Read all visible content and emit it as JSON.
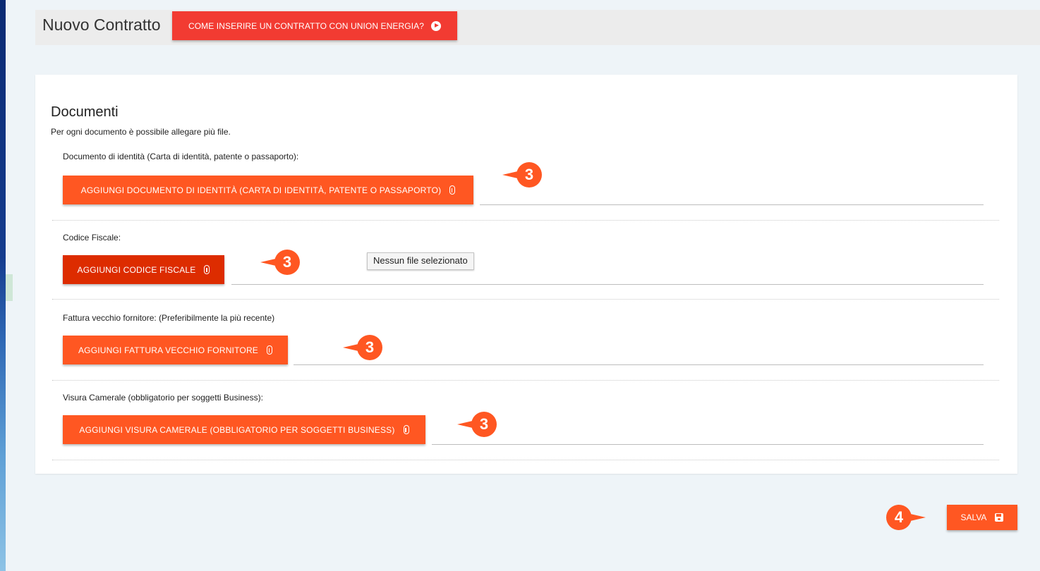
{
  "header": {
    "title": "Nuovo Contratto",
    "video_button_label": "COME INSERIRE UN CONTRATTO CON UNION ENERGIA?"
  },
  "documents": {
    "title": "Documenti",
    "subtitle": "Per ogni documento è possibile allegare più file.",
    "items": [
      {
        "label": "Documento di identità (Carta di identità, patente o passaporto):",
        "button": "AGGIUNGI DOCUMENTO DI IDENTITÀ (CARTA DI IDENTITÀ, PATENTE O PASSAPORTO)",
        "marker": "3"
      },
      {
        "label": "Codice Fiscale:",
        "button": "AGGIUNGI CODICE FISCALE",
        "marker": "3"
      },
      {
        "label": "Fattura vecchio fornitore:  (Preferibilmente la più recente)",
        "button": "AGGIUNGI FATTURA VECCHIO FORNITORE",
        "marker": "3"
      },
      {
        "label": "Visura Camerale (obbligatorio per soggetti Business):",
        "button": "AGGIUNGI VISURA CAMERALE (OBBLIGATORIO PER SOGGETTI BUSINESS)",
        "marker": "3"
      }
    ],
    "tooltip": "Nessun file selezionato"
  },
  "footer": {
    "save_label": "SALVA",
    "marker": "4"
  },
  "colors": {
    "accent": "#ff5722",
    "accent_active": "#dd2c00",
    "header_button": "#f23b32"
  },
  "icons": {
    "video_button": "play-circle-icon",
    "upload_button": "paperclip-icon",
    "save_button": "floppy-disk-icon"
  }
}
